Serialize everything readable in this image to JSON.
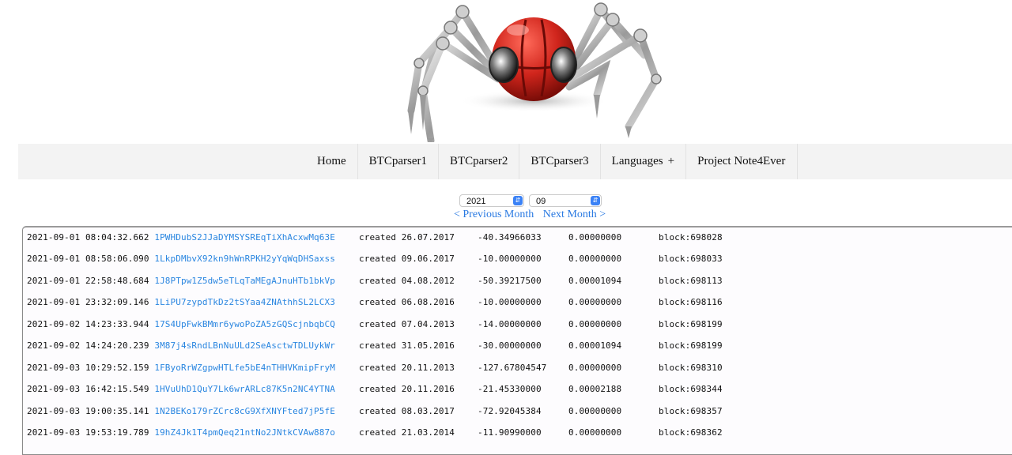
{
  "logo": {
    "alt": "robot spider logo"
  },
  "nav": {
    "items": [
      {
        "label": "Home"
      },
      {
        "label": "BTCparser1"
      },
      {
        "label": "BTCparser2"
      },
      {
        "label": "BTCparser3"
      },
      {
        "label": "Languages",
        "suffix": "+"
      },
      {
        "label": "Project Note4Ever"
      }
    ]
  },
  "filters": {
    "year": "2021",
    "month": "09",
    "prev_label": "< Previous Month",
    "next_label": "Next Month >"
  },
  "transactions": [
    {
      "timestamp": "2021-09-01 08:04:32.662",
      "address": "1PWHDubS2JJaDYMSYSREqTiXhAcxwMq63E",
      "created": "created 26.07.2017",
      "amount": "-40.34966033",
      "fee": "0.00000000",
      "block": "block:698028"
    },
    {
      "timestamp": "2021-09-01 08:58:06.090",
      "address": "1LkpDMbvX92kn9hWnRPKH2yYqWqDHSaxss",
      "created": "created 09.06.2017",
      "amount": "-10.00000000",
      "fee": "0.00000000",
      "block": "block:698033"
    },
    {
      "timestamp": "2021-09-01 22:58:48.684",
      "address": "1J8PTpw1Z5dw5eTLqTaMEgAJnuHTb1bkVp",
      "created": "created 04.08.2012",
      "amount": "-50.39217500",
      "fee": "0.00001094",
      "block": "block:698113"
    },
    {
      "timestamp": "2021-09-01 23:32:09.146",
      "address": "1LiPU7zypdTkDz2tSYaa4ZNAthhSL2LCX3",
      "created": "created 06.08.2016",
      "amount": "-10.00000000",
      "fee": "0.00000000",
      "block": "block:698116"
    },
    {
      "timestamp": "2021-09-02 14:23:33.944",
      "address": "17S4UpFwkBMmr6ywoPoZA5zGQScjnbqbCQ",
      "created": "created 07.04.2013",
      "amount": "-14.00000000",
      "fee": "0.00000000",
      "block": "block:698199"
    },
    {
      "timestamp": "2021-09-02 14:24:20.239",
      "address": "3M87j4sRndLBnNuULd2SeAsctwTDLUykWr",
      "created": "created 31.05.2016",
      "amount": "-30.00000000",
      "fee": "0.00001094",
      "block": "block:698199"
    },
    {
      "timestamp": "2021-09-03 10:29:52.159",
      "address": "1FByoRrWZgpwHTLfe5bE4nTHHVKmipFryM",
      "created": "created 20.11.2013",
      "amount": "-127.67804547",
      "fee": "0.00000000",
      "block": "block:698310"
    },
    {
      "timestamp": "2021-09-03 16:42:15.549",
      "address": "1HVuUhD1QuY7Lk6wrARLc87K5n2NC4YTNA",
      "created": "created 20.11.2016",
      "amount": "-21.45330000",
      "fee": "0.00002188",
      "block": "block:698344"
    },
    {
      "timestamp": "2021-09-03 19:00:35.141",
      "address": "1N2BEKo179rZCrc8cG9XfXNYFted7jP5fE",
      "created": "created 08.03.2017",
      "amount": "-72.92045384",
      "fee": "0.00000000",
      "block": "block:698357"
    },
    {
      "timestamp": "2021-09-03 19:53:19.789",
      "address": "19hZ4Jk1T4pmQeq21ntNo2JNtkCVAw887o",
      "created": "created 21.03.2014",
      "amount": "-11.90990000",
      "fee": "0.00000000",
      "block": "block:698362"
    }
  ],
  "colors": {
    "link": "#2a86e0",
    "navbar_bg": "#f3f3f3",
    "stepper": "#3b82f6"
  }
}
